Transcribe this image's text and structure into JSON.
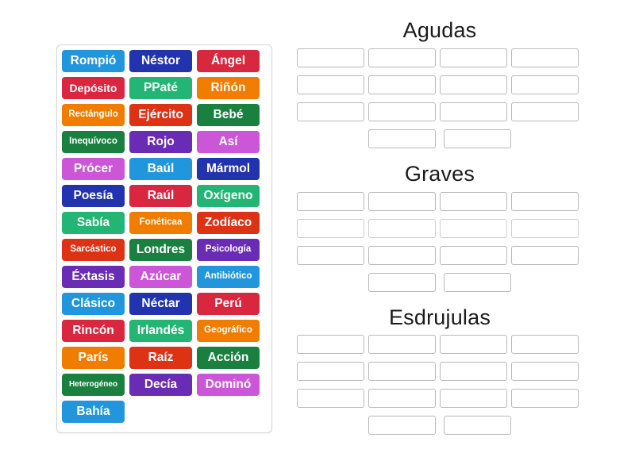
{
  "word_bank": {
    "name": "word-bank",
    "tiles": [
      {
        "label": "Rompió",
        "color": "#2196dd",
        "size": "s-lg"
      },
      {
        "label": "Néstor",
        "color": "#2233b0",
        "size": "s-lg"
      },
      {
        "label": "Ángel",
        "color": "#d8273f",
        "size": "s-lg"
      },
      {
        "label": "Depósito",
        "color": "#d8273f",
        "size": "s-md"
      },
      {
        "label": "PPaté",
        "color": "#22b573",
        "size": "s-lg"
      },
      {
        "label": "Riñón",
        "color": "#f07d00",
        "size": "s-lg"
      },
      {
        "label": "Rectángulo",
        "color": "#f07d00",
        "size": "s-sm"
      },
      {
        "label": "Ejército",
        "color": "#dd3314",
        "size": "s-lg"
      },
      {
        "label": "Bebé",
        "color": "#1a8040",
        "size": "s-lg"
      },
      {
        "label": "Inequívoco",
        "color": "#1a8040",
        "size": "s-sm"
      },
      {
        "label": "Rojo",
        "color": "#6a2bb5",
        "size": "s-lg"
      },
      {
        "label": "Así",
        "color": "#cc56d8",
        "size": "s-lg"
      },
      {
        "label": "Prócer",
        "color": "#cc56d8",
        "size": "s-lg"
      },
      {
        "label": "Baúl",
        "color": "#2196dd",
        "size": "s-lg"
      },
      {
        "label": "Mármol",
        "color": "#2233b0",
        "size": "s-lg"
      },
      {
        "label": "Poesía",
        "color": "#2233b0",
        "size": "s-lg"
      },
      {
        "label": "Raúl",
        "color": "#d8273f",
        "size": "s-lg"
      },
      {
        "label": "Oxígeno",
        "color": "#22b573",
        "size": "s-lg"
      },
      {
        "label": "Sabía",
        "color": "#22b573",
        "size": "s-lg"
      },
      {
        "label": "Fonéticaa",
        "color": "#f07d00",
        "size": "s-sm"
      },
      {
        "label": "Zodíaco",
        "color": "#dd3314",
        "size": "s-lg"
      },
      {
        "label": "Sarcástico",
        "color": "#dd3314",
        "size": "s-sm"
      },
      {
        "label": "Londres",
        "color": "#1a8040",
        "size": "s-lg"
      },
      {
        "label": "Psicología",
        "color": "#6a2bb5",
        "size": "s-sm"
      },
      {
        "label": "Éxtasis",
        "color": "#6a2bb5",
        "size": "s-lg"
      },
      {
        "label": "Azúcar",
        "color": "#cc56d8",
        "size": "s-lg"
      },
      {
        "label": "Antibiótico",
        "color": "#2196dd",
        "size": "s-sm"
      },
      {
        "label": "Clásico",
        "color": "#2196dd",
        "size": "s-lg"
      },
      {
        "label": "Néctar",
        "color": "#2233b0",
        "size": "s-lg"
      },
      {
        "label": "Perú",
        "color": "#d8273f",
        "size": "s-lg"
      },
      {
        "label": "Rincón",
        "color": "#d8273f",
        "size": "s-lg"
      },
      {
        "label": "Irlandés",
        "color": "#22b573",
        "size": "s-lg"
      },
      {
        "label": "Geográfico",
        "color": "#f07d00",
        "size": "s-sm"
      },
      {
        "label": "París",
        "color": "#f07d00",
        "size": "s-lg"
      },
      {
        "label": "Raíz",
        "color": "#dd3314",
        "size": "s-lg"
      },
      {
        "label": "Acción",
        "color": "#1a8040",
        "size": "s-lg"
      },
      {
        "label": "Heterogéneo",
        "color": "#1a8040",
        "size": "s-xs"
      },
      {
        "label": "Decía",
        "color": "#6a2bb5",
        "size": "s-lg"
      },
      {
        "label": "Dominó",
        "color": "#cc56d8",
        "size": "s-lg"
      },
      {
        "label": "Bahía",
        "color": "#2196dd",
        "size": "s-lg"
      }
    ]
  },
  "categories": [
    {
      "title": "Agudas",
      "slug": "agudas",
      "rows": [
        4,
        4,
        4,
        2
      ]
    },
    {
      "title": "Graves",
      "slug": "graves",
      "rows": [
        4,
        4,
        4,
        2
      ]
    },
    {
      "title": "Esdrujulas",
      "slug": "esdrujulas",
      "rows": [
        4,
        4,
        4,
        2
      ]
    }
  ]
}
